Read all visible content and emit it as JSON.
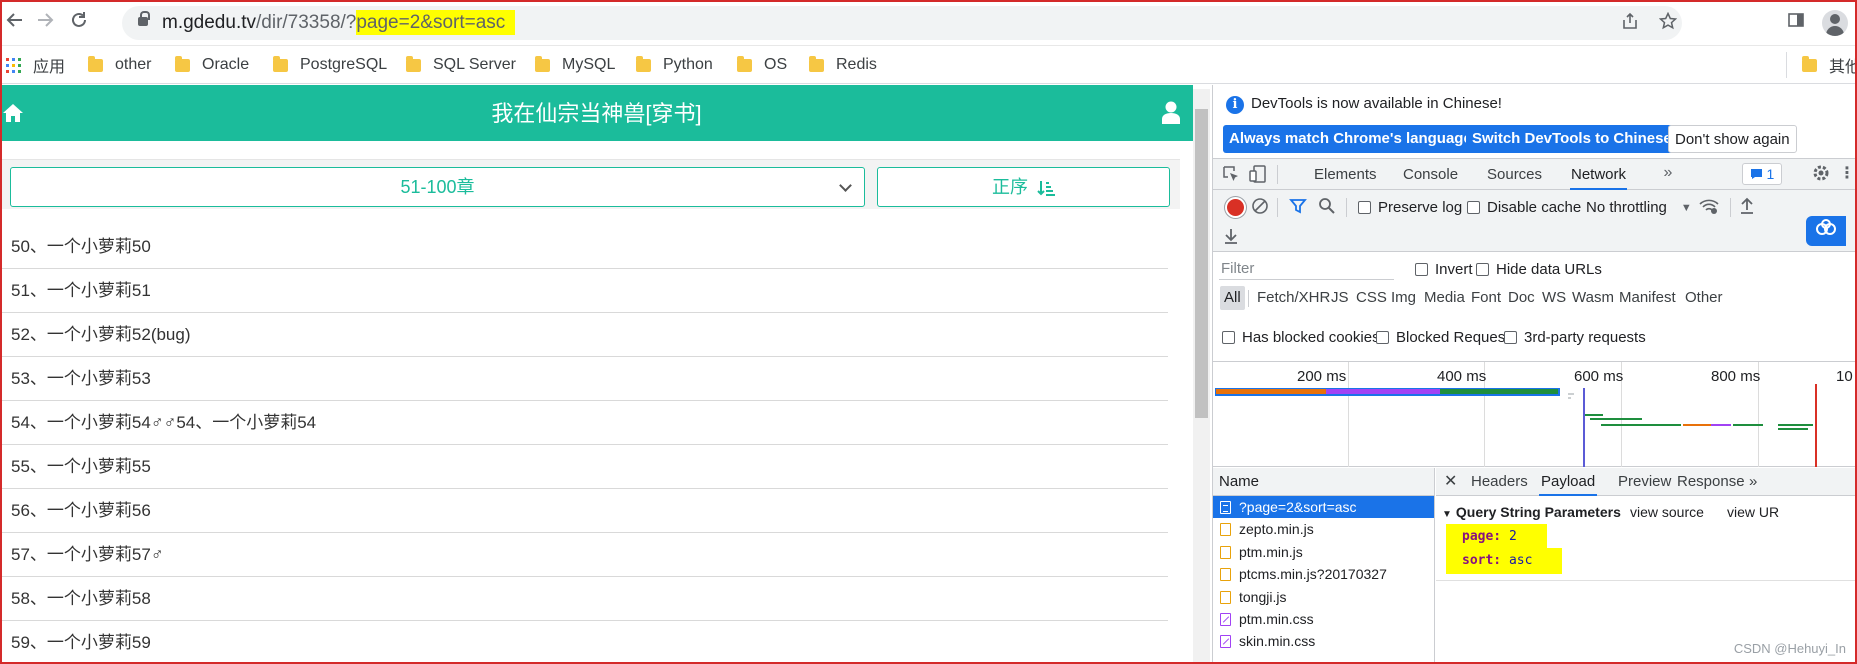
{
  "browser": {
    "url_host": "m.gdedu.tv",
    "url_path": "/dir/73358/?",
    "url_query": "page=2&sort=asc"
  },
  "bookmarks": {
    "apps_label": "应用",
    "items": [
      "other",
      "Oracle",
      "PostgreSQL",
      "SQL Server",
      "MySQL",
      "Python",
      "OS",
      "Redis"
    ],
    "overflow_label": "其他"
  },
  "site": {
    "title": "我在仙宗当神兽[穿书]",
    "chapter_range": "51-100章",
    "sort_label": "正序",
    "brand_color": "#1bbc9b",
    "chapters": [
      "50、一个小萝莉50",
      "51、一个小萝莉51",
      "52、一个小萝莉52(bug)",
      "53、一个小萝莉53",
      "54、一个小萝莉54♂♂54、一个小萝莉54",
      "55、一个小萝莉55",
      "56、一个小萝莉56",
      "57、一个小萝莉57♂",
      "58、一个小萝莉58",
      "59、一个小萝莉59"
    ]
  },
  "devtools": {
    "banner_text": "DevTools is now available in Chinese!",
    "btn_match": "Always match Chrome's language",
    "btn_switch": "Switch DevTools to Chinese",
    "btn_dismiss": "Don't show again",
    "tabs": [
      "Elements",
      "Console",
      "Sources",
      "Network"
    ],
    "issues_count": "1",
    "preserve_log": "Preserve log",
    "disable_cache": "Disable cache",
    "throttling": "No throttling",
    "filter_placeholder": "Filter",
    "invert": "Invert",
    "hide_data_urls": "Hide data URLs",
    "types": [
      "All",
      "Fetch/XHR",
      "JS",
      "CSS",
      "Img",
      "Media",
      "Font",
      "Doc",
      "WS",
      "Wasm",
      "Manifest",
      "Other"
    ],
    "has_blocked_cookies": "Has blocked cookies",
    "blocked_requests": "Blocked Requests",
    "third_party": "3rd-party requests",
    "timeline_ticks": [
      "200 ms",
      "400 ms",
      "600 ms",
      "800 ms",
      "10"
    ],
    "name_header": "Name",
    "requests": [
      "?page=2&sort=asc",
      "zepto.min.js",
      "ptm.min.js",
      "ptcms.min.js?20170327",
      "tongji.js",
      "ptm.min.css",
      "skin.min.css"
    ],
    "detail_tabs": [
      "Headers",
      "Payload",
      "Preview",
      "Response"
    ],
    "qs_title": "Query String Parameters",
    "view_source": "view source",
    "view_url": "view UR",
    "params": [
      {
        "key": "page:",
        "value": "2"
      },
      {
        "key": "sort:",
        "value": "asc"
      }
    ],
    "watermark": "CSDN @Hehuyi_In"
  }
}
